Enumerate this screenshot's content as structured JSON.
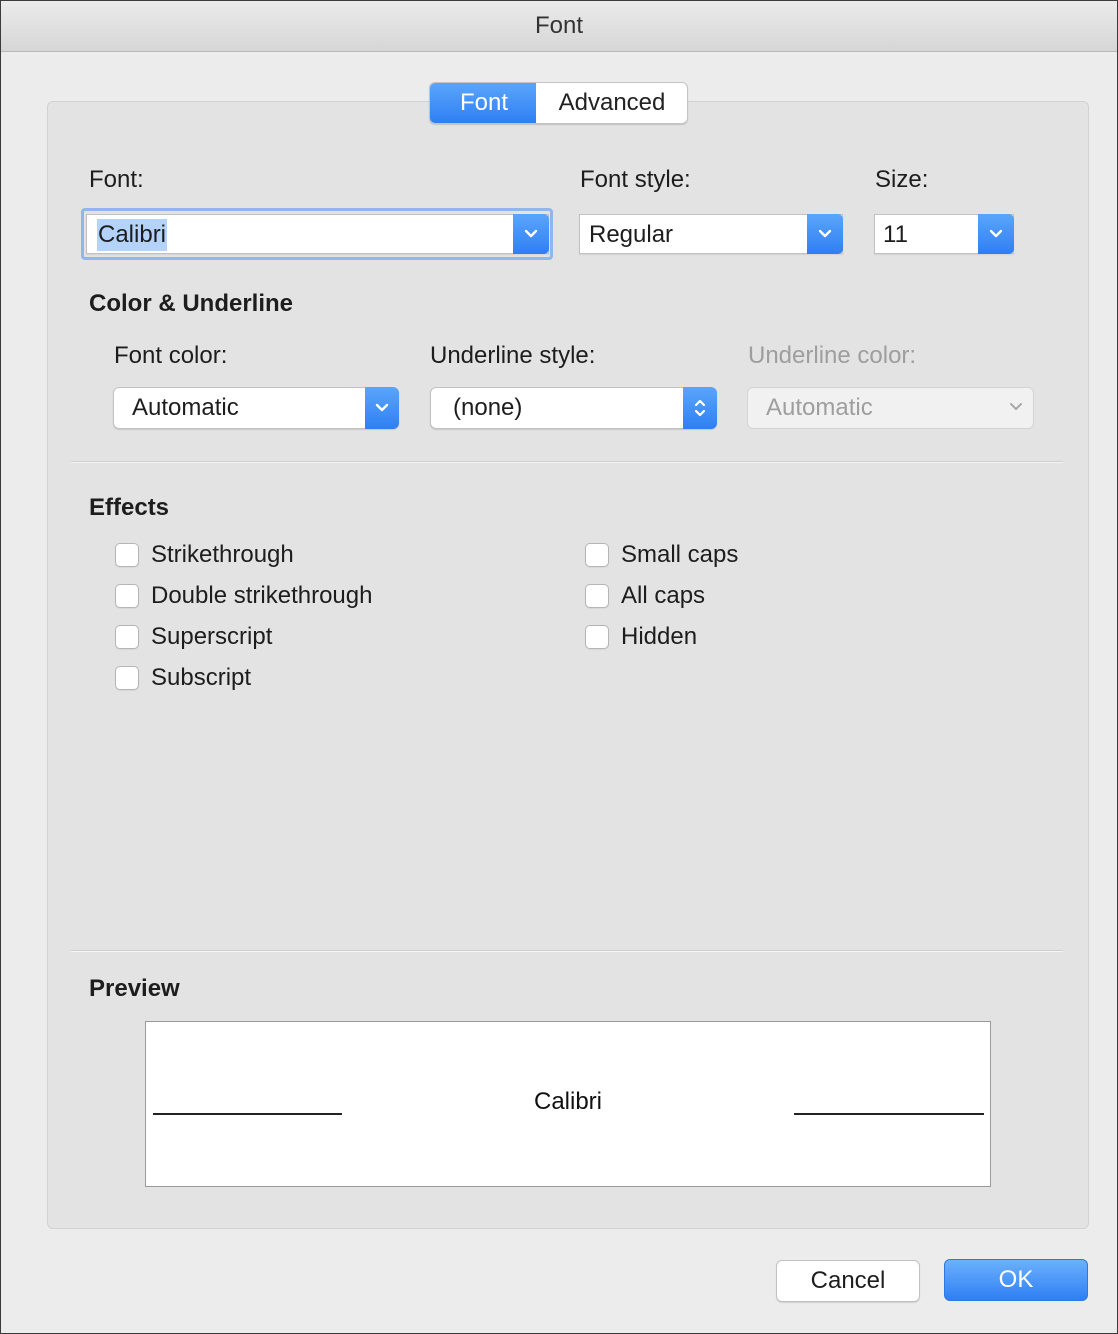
{
  "window": {
    "title": "Font"
  },
  "tabs": [
    {
      "label": "Font",
      "active": true
    },
    {
      "label": "Advanced",
      "active": false
    }
  ],
  "font_section": {
    "font_label": "Font:",
    "font_value": "Calibri",
    "style_label": "Font style:",
    "style_value": "Regular",
    "size_label": "Size:",
    "size_value": "11"
  },
  "color_underline": {
    "heading": "Color & Underline",
    "font_color_label": "Font color:",
    "font_color_value": "Automatic",
    "underline_style_label": "Underline style:",
    "underline_style_value": "(none)",
    "underline_color_label": "Underline color:",
    "underline_color_value": "Automatic"
  },
  "effects": {
    "heading": "Effects",
    "left": [
      "Strikethrough",
      "Double strikethrough",
      "Superscript",
      "Subscript"
    ],
    "right": [
      "Small caps",
      "All caps",
      "Hidden"
    ]
  },
  "preview": {
    "heading": "Preview",
    "sample": "Calibri"
  },
  "buttons": {
    "cancel": "Cancel",
    "ok": "OK"
  },
  "colors": {
    "accent": "#2f7ff4",
    "panel": "#e3e3e3",
    "window": "#ececec"
  }
}
